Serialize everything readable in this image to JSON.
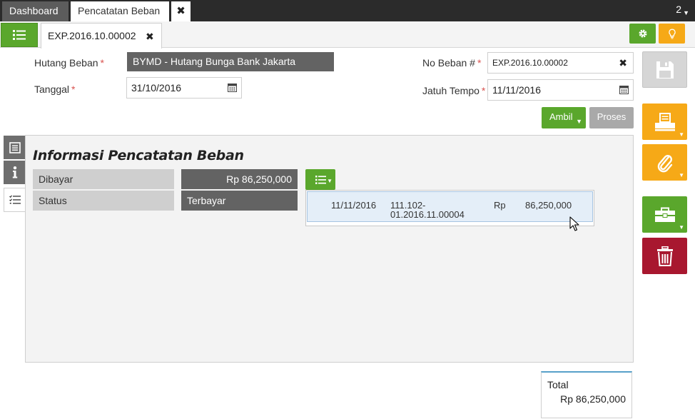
{
  "top_tabs": {
    "dashboard": "Dashboard",
    "active_tab": "Pencatatan Beban",
    "close_symbol": "✖",
    "count": "2"
  },
  "subbar": {
    "doc_tab_label": "EXP.2016.10.00002",
    "close_symbol": "✖",
    "icons": [
      "list-icon",
      "gear-icon",
      "lightbulb-icon"
    ]
  },
  "form": {
    "hutang_beban_label": "Hutang Beban",
    "hutang_beban_value": "BYMD - Hutang Bunga Bank Jakarta",
    "tanggal_label": "Tanggal",
    "tanggal_value": "31/10/2016",
    "no_beban_label": "No Beban #",
    "no_beban_value": "EXP.2016.10.00002",
    "jatuh_tempo_label": "Jatuh Tempo",
    "jatuh_tempo_value": "11/11/2016",
    "required_mark": "*"
  },
  "actions": {
    "ambil": "Ambil",
    "proses": "Proses"
  },
  "panel": {
    "title": "Informasi Pencatatan Beban",
    "dibayar_label": "Dibayar",
    "dibayar_value": "Rp 86,250,000",
    "status_label": "Status",
    "status_value": "Terbayar"
  },
  "payment_dropdown": {
    "rows": [
      {
        "date": "11/11/2016",
        "ref_line1": "111.102-",
        "ref_line2": "01.2016.11.00004",
        "currency": "Rp",
        "amount": "86,250,000"
      }
    ]
  },
  "total": {
    "label": "Total",
    "value": "Rp 86,250,000"
  },
  "colors": {
    "green": "#5aa72c",
    "orange": "#f6a917",
    "red": "#a8172f",
    "dark_field": "#636363",
    "disabled": "#a9a9a9"
  }
}
